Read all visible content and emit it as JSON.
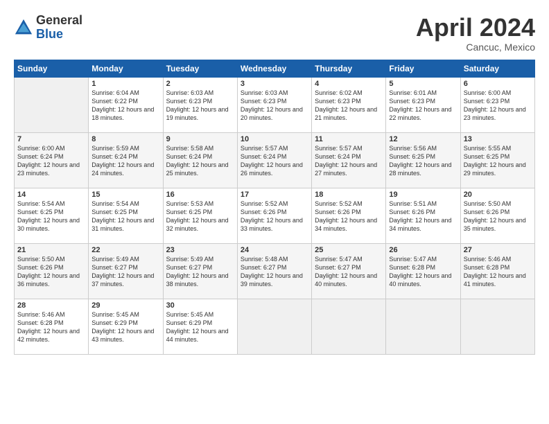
{
  "header": {
    "logo_general": "General",
    "logo_blue": "Blue",
    "month_title": "April 2024",
    "location": "Cancuc, Mexico"
  },
  "calendar": {
    "weekdays": [
      "Sunday",
      "Monday",
      "Tuesday",
      "Wednesday",
      "Thursday",
      "Friday",
      "Saturday"
    ],
    "weeks": [
      [
        {
          "day": "",
          "sunrise": "",
          "sunset": "",
          "daylight": "",
          "empty": true
        },
        {
          "day": "1",
          "sunrise": "Sunrise: 6:04 AM",
          "sunset": "Sunset: 6:22 PM",
          "daylight": "Daylight: 12 hours and 18 minutes."
        },
        {
          "day": "2",
          "sunrise": "Sunrise: 6:03 AM",
          "sunset": "Sunset: 6:23 PM",
          "daylight": "Daylight: 12 hours and 19 minutes."
        },
        {
          "day": "3",
          "sunrise": "Sunrise: 6:03 AM",
          "sunset": "Sunset: 6:23 PM",
          "daylight": "Daylight: 12 hours and 20 minutes."
        },
        {
          "day": "4",
          "sunrise": "Sunrise: 6:02 AM",
          "sunset": "Sunset: 6:23 PM",
          "daylight": "Daylight: 12 hours and 21 minutes."
        },
        {
          "day": "5",
          "sunrise": "Sunrise: 6:01 AM",
          "sunset": "Sunset: 6:23 PM",
          "daylight": "Daylight: 12 hours and 22 minutes."
        },
        {
          "day": "6",
          "sunrise": "Sunrise: 6:00 AM",
          "sunset": "Sunset: 6:23 PM",
          "daylight": "Daylight: 12 hours and 23 minutes."
        }
      ],
      [
        {
          "day": "7",
          "sunrise": "Sunrise: 6:00 AM",
          "sunset": "Sunset: 6:24 PM",
          "daylight": "Daylight: 12 hours and 23 minutes."
        },
        {
          "day": "8",
          "sunrise": "Sunrise: 5:59 AM",
          "sunset": "Sunset: 6:24 PM",
          "daylight": "Daylight: 12 hours and 24 minutes."
        },
        {
          "day": "9",
          "sunrise": "Sunrise: 5:58 AM",
          "sunset": "Sunset: 6:24 PM",
          "daylight": "Daylight: 12 hours and 25 minutes."
        },
        {
          "day": "10",
          "sunrise": "Sunrise: 5:57 AM",
          "sunset": "Sunset: 6:24 PM",
          "daylight": "Daylight: 12 hours and 26 minutes."
        },
        {
          "day": "11",
          "sunrise": "Sunrise: 5:57 AM",
          "sunset": "Sunset: 6:24 PM",
          "daylight": "Daylight: 12 hours and 27 minutes."
        },
        {
          "day": "12",
          "sunrise": "Sunrise: 5:56 AM",
          "sunset": "Sunset: 6:25 PM",
          "daylight": "Daylight: 12 hours and 28 minutes."
        },
        {
          "day": "13",
          "sunrise": "Sunrise: 5:55 AM",
          "sunset": "Sunset: 6:25 PM",
          "daylight": "Daylight: 12 hours and 29 minutes."
        }
      ],
      [
        {
          "day": "14",
          "sunrise": "Sunrise: 5:54 AM",
          "sunset": "Sunset: 6:25 PM",
          "daylight": "Daylight: 12 hours and 30 minutes."
        },
        {
          "day": "15",
          "sunrise": "Sunrise: 5:54 AM",
          "sunset": "Sunset: 6:25 PM",
          "daylight": "Daylight: 12 hours and 31 minutes."
        },
        {
          "day": "16",
          "sunrise": "Sunrise: 5:53 AM",
          "sunset": "Sunset: 6:25 PM",
          "daylight": "Daylight: 12 hours and 32 minutes."
        },
        {
          "day": "17",
          "sunrise": "Sunrise: 5:52 AM",
          "sunset": "Sunset: 6:26 PM",
          "daylight": "Daylight: 12 hours and 33 minutes."
        },
        {
          "day": "18",
          "sunrise": "Sunrise: 5:52 AM",
          "sunset": "Sunset: 6:26 PM",
          "daylight": "Daylight: 12 hours and 34 minutes."
        },
        {
          "day": "19",
          "sunrise": "Sunrise: 5:51 AM",
          "sunset": "Sunset: 6:26 PM",
          "daylight": "Daylight: 12 hours and 34 minutes."
        },
        {
          "day": "20",
          "sunrise": "Sunrise: 5:50 AM",
          "sunset": "Sunset: 6:26 PM",
          "daylight": "Daylight: 12 hours and 35 minutes."
        }
      ],
      [
        {
          "day": "21",
          "sunrise": "Sunrise: 5:50 AM",
          "sunset": "Sunset: 6:26 PM",
          "daylight": "Daylight: 12 hours and 36 minutes."
        },
        {
          "day": "22",
          "sunrise": "Sunrise: 5:49 AM",
          "sunset": "Sunset: 6:27 PM",
          "daylight": "Daylight: 12 hours and 37 minutes."
        },
        {
          "day": "23",
          "sunrise": "Sunrise: 5:49 AM",
          "sunset": "Sunset: 6:27 PM",
          "daylight": "Daylight: 12 hours and 38 minutes."
        },
        {
          "day": "24",
          "sunrise": "Sunrise: 5:48 AM",
          "sunset": "Sunset: 6:27 PM",
          "daylight": "Daylight: 12 hours and 39 minutes."
        },
        {
          "day": "25",
          "sunrise": "Sunrise: 5:47 AM",
          "sunset": "Sunset: 6:27 PM",
          "daylight": "Daylight: 12 hours and 40 minutes."
        },
        {
          "day": "26",
          "sunrise": "Sunrise: 5:47 AM",
          "sunset": "Sunset: 6:28 PM",
          "daylight": "Daylight: 12 hours and 40 minutes."
        },
        {
          "day": "27",
          "sunrise": "Sunrise: 5:46 AM",
          "sunset": "Sunset: 6:28 PM",
          "daylight": "Daylight: 12 hours and 41 minutes."
        }
      ],
      [
        {
          "day": "28",
          "sunrise": "Sunrise: 5:46 AM",
          "sunset": "Sunset: 6:28 PM",
          "daylight": "Daylight: 12 hours and 42 minutes."
        },
        {
          "day": "29",
          "sunrise": "Sunrise: 5:45 AM",
          "sunset": "Sunset: 6:29 PM",
          "daylight": "Daylight: 12 hours and 43 minutes."
        },
        {
          "day": "30",
          "sunrise": "Sunrise: 5:45 AM",
          "sunset": "Sunset: 6:29 PM",
          "daylight": "Daylight: 12 hours and 44 minutes."
        },
        {
          "day": "",
          "sunrise": "",
          "sunset": "",
          "daylight": "",
          "empty": true
        },
        {
          "day": "",
          "sunrise": "",
          "sunset": "",
          "daylight": "",
          "empty": true
        },
        {
          "day": "",
          "sunrise": "",
          "sunset": "",
          "daylight": "",
          "empty": true
        },
        {
          "day": "",
          "sunrise": "",
          "sunset": "",
          "daylight": "",
          "empty": true
        }
      ]
    ]
  }
}
